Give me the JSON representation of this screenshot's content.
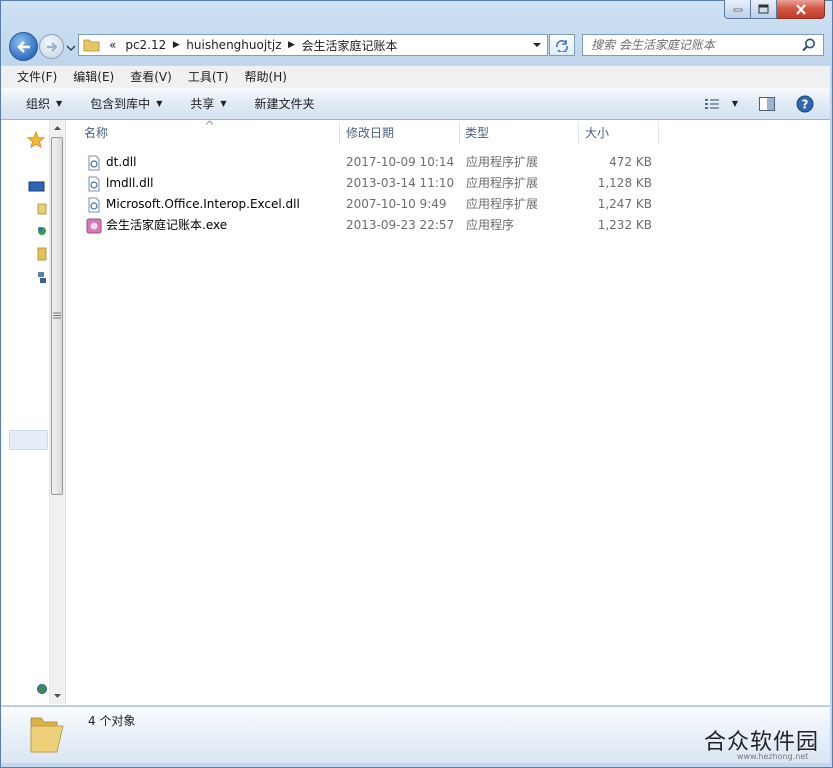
{
  "window": {
    "minimize_icon": "minimize-icon",
    "maximize_icon": "maximize-icon",
    "close_icon": "close-icon"
  },
  "nav": {
    "overflow": "«",
    "breadcrumbs": [
      "pc2.12",
      "huishenghuojtjz",
      "会生活家庭记账本"
    ],
    "search_placeholder": "搜索 会生活家庭记账本"
  },
  "menu": [
    "文件(F)",
    "编辑(E)",
    "查看(V)",
    "工具(T)",
    "帮助(H)"
  ],
  "toolbar": {
    "organize": "组织",
    "include_library": "包含到库中",
    "share": "共享",
    "new_folder": "新建文件夹"
  },
  "columns": {
    "name": "名称",
    "modified": "修改日期",
    "type": "类型",
    "size": "大小"
  },
  "files": [
    {
      "name": "dt.dll",
      "modified": "2017-10-09 10:14",
      "type": "应用程序扩展",
      "size": "472 KB",
      "icon": "dll-file-icon"
    },
    {
      "name": "lmdll.dll",
      "modified": "2013-03-14 11:10",
      "type": "应用程序扩展",
      "size": "1,128 KB",
      "icon": "dll-file-icon"
    },
    {
      "name": "Microsoft.Office.Interop.Excel.dll",
      "modified": "2007-10-10 9:49",
      "type": "应用程序扩展",
      "size": "1,247 KB",
      "icon": "dll-file-icon"
    },
    {
      "name": "会生活家庭记账本.exe",
      "modified": "2013-09-23 22:57",
      "type": "应用程序",
      "size": "1,232 KB",
      "icon": "app-exe-icon"
    }
  ],
  "status": {
    "count": "4 个对象"
  },
  "watermark": {
    "text": "合众软件园",
    "url": "www.hezhong.net"
  },
  "colors": {
    "accent": "#2e6fbf",
    "close": "#c33b26",
    "frame": "#c3d8ed"
  }
}
